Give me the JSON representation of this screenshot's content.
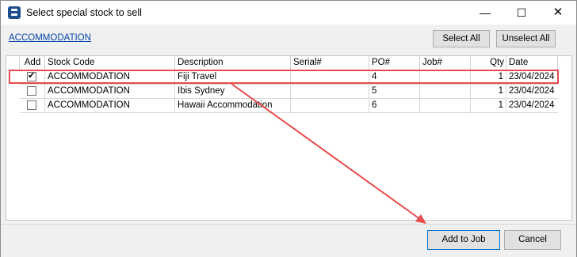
{
  "window": {
    "title": "Select special stock to sell"
  },
  "window_controls": {
    "minimize": "—",
    "maximize": "☐",
    "close": "✕"
  },
  "group_link": "ACCOMMODATION",
  "toolbar": {
    "select_all": "Select All",
    "unselect_all": "Unselect All"
  },
  "grid": {
    "columns": [
      "Add",
      "Stock Code",
      "Description",
      "Serial#",
      "PO#",
      "Job#",
      "Qty",
      "Date"
    ],
    "row_marker": "I",
    "rows": [
      {
        "add": true,
        "stock_code": "ACCOMMODATION",
        "description": "Fiji Travel",
        "serial": "",
        "po": "4",
        "job": "",
        "qty": "1",
        "date": "23/04/2024"
      },
      {
        "add": false,
        "stock_code": "ACCOMMODATION",
        "description": "Ibis Sydney",
        "serial": "",
        "po": "5",
        "job": "",
        "qty": "1",
        "date": "23/04/2024"
      },
      {
        "add": false,
        "stock_code": "ACCOMMODATION",
        "description": "Hawaii Accommodation",
        "serial": "",
        "po": "6",
        "job": "",
        "qty": "1",
        "date": "23/04/2024"
      }
    ]
  },
  "footer": {
    "add_to_job": "Add to Job",
    "cancel": "Cancel"
  },
  "colors": {
    "annotation": "#e84c4c",
    "link": "#0645ad",
    "default_button_border": "#0078d7"
  }
}
